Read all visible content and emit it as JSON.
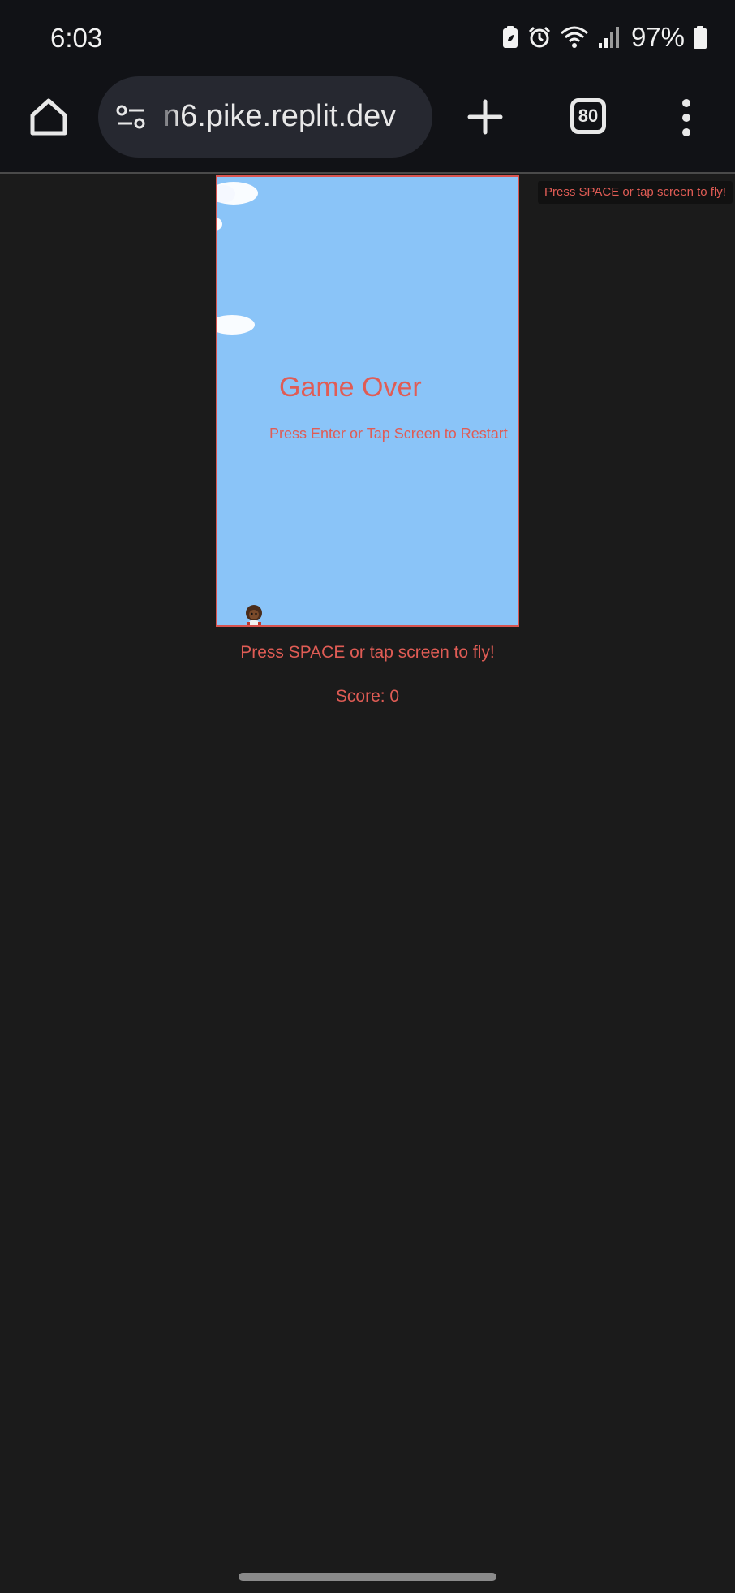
{
  "status_bar": {
    "time": "6:03",
    "battery_percent": "97%",
    "icons": [
      "battery-saver-icon",
      "alarm-icon",
      "wifi-icon",
      "signal-icon",
      "battery-icon"
    ]
  },
  "browser": {
    "url": "n6.pike.replit.dev",
    "tab_count": "80",
    "icons": [
      "home-icon",
      "site-settings-icon",
      "new-tab-icon",
      "tab-switcher-icon",
      "more-options-icon"
    ]
  },
  "game": {
    "game_over_text": "Game Over",
    "restart_text": "Press Enter or Tap Screen to Restart",
    "sky_color": "#8ac4f8",
    "text_color": "#e05c55"
  },
  "page": {
    "corner_hint": "Press SPACE or tap screen to fly!",
    "instruction": "Press SPACE or tap screen to fly!",
    "score": "Score: 0"
  }
}
